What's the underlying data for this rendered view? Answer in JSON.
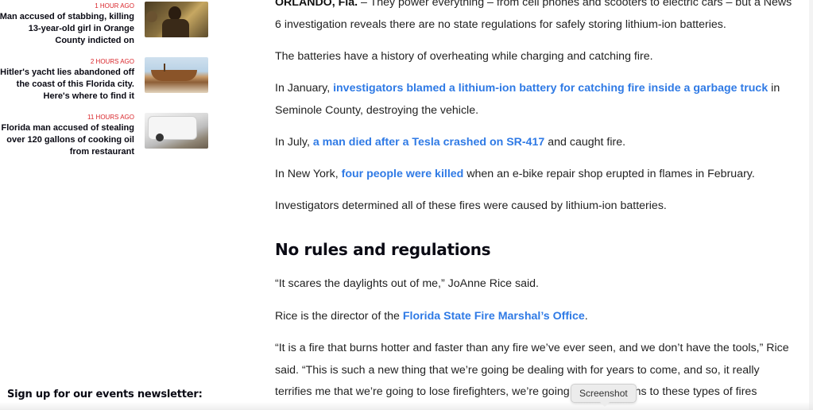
{
  "sidebar": {
    "stories": [
      {
        "time": "1 HOUR AGO",
        "headline": "Man accused of stabbing, killing 13-year-old girl in Orange County indicted on",
        "thumb": "photo-men-indoors"
      },
      {
        "time": "2 HOURS AGO",
        "headline": "Hitler's yacht lies abandoned off the coast of this Florida city. Here's where to find it",
        "thumb": "photo-abandoned-yacht"
      },
      {
        "time": "11 HOURS AGO",
        "headline": "Florida man accused of stealing over 120 gallons of cooking oil from restaurant",
        "thumb": "photo-white-van"
      }
    ],
    "newsletter_label": "Sign up for our events newsletter:"
  },
  "article": {
    "p1": {
      "dateline": "ORLANDO, Fla.",
      "text": " – They power everything – from cell phones and scooters to electric cars – but a News 6 investigation reveals there are no state regulations for safely storing lithium-ion batteries."
    },
    "p2": "The batteries have a history of overheating while charging and catching fire.",
    "p3": {
      "before": "In January, ",
      "link": "investigators blamed a lithium-ion battery for catching fire inside a garbage truck",
      "after": " in Seminole County, destroying the vehicle."
    },
    "p4": {
      "before": "In July, ",
      "link": "a man died after a Tesla crashed on SR-417",
      "after": " and caught fire."
    },
    "p5": {
      "before": "In New York, ",
      "link": "four people were killed",
      "after": " when an e-bike repair shop erupted in flames in February."
    },
    "p6": "Investigators determined all of these fires were caused by lithium-ion batteries.",
    "heading": "No rules and regulations",
    "p7": "“It scares the daylights out of me,” JoAnne Rice said.",
    "p8": {
      "before": "Rice is the director of the ",
      "link": "Florida State Fire Marshal’s Office",
      "after": "."
    },
    "p9": "“It is a fire that burns hotter and faster than any fire we’ve ever seen, and we don’t have the tools,” Rice said. “This is such a new thing that we’re going be dealing with for years to come, and so, it really terrifies me that we’re going to lose firefighters, we’re going to lose citizens to these types of fires"
  },
  "tooltip": {
    "label": "Screenshot"
  },
  "colors": {
    "accent_link": "#2f7ae5",
    "time_red": "#d9252a",
    "heading": "#0a0a14"
  }
}
